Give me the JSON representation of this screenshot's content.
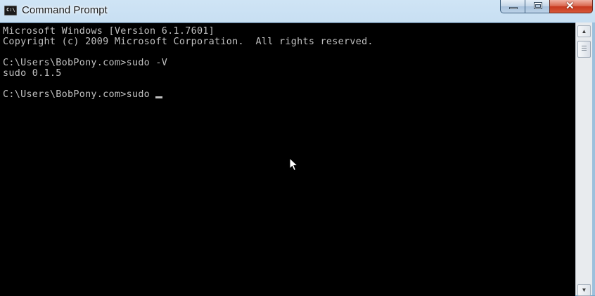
{
  "window": {
    "title": "Command Prompt",
    "icon_text": "C:\\",
    "controls": {
      "minimize": "minimize-icon",
      "maximize": "maximize-icon",
      "close": "close-icon"
    }
  },
  "console": {
    "background": "#000000",
    "foreground": "#c0c0c0",
    "lines": [
      "Microsoft Windows [Version 6.1.7601]",
      "Copyright (c) 2009 Microsoft Corporation.  All rights reserved.",
      "C:\\Users\\BobPony.com>sudo -V",
      "sudo 0.1.5",
      "C:\\Users\\BobPony.com>sudo "
    ]
  },
  "scrollbar": {
    "up_arrow": "▲",
    "down_arrow": "▼"
  }
}
